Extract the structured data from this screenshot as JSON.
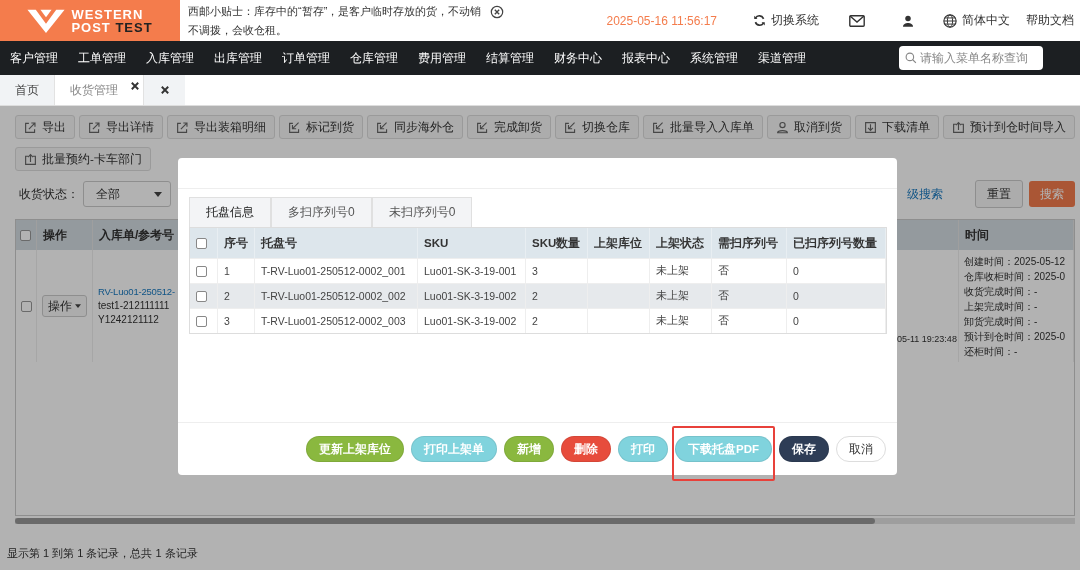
{
  "header": {
    "logo": {
      "line1": "WESTERN",
      "line2a": "POST",
      "line2b": "TEST"
    },
    "tip": "西邮小贴士：库存中的“暂存”，是客户临时存放的货，不动销不调拨，会收仓租。",
    "datetime": "2025-05-16 11:56:17",
    "switch_system": "切换系统",
    "language": "简体中文",
    "help": "帮助文档"
  },
  "nav": {
    "items": [
      "客户管理",
      "工单管理",
      "入库管理",
      "出库管理",
      "订单管理",
      "仓库管理",
      "费用管理",
      "结算管理",
      "财务中心",
      "报表中心",
      "系统管理",
      "渠道管理"
    ],
    "search": {
      "placeholder": "请输入菜单名称查询"
    }
  },
  "page_tabs": [
    {
      "label": "首页",
      "selected": false,
      "closable": false
    },
    {
      "label": "收货管理",
      "selected": true,
      "closable": true
    }
  ],
  "close_all_tab": true,
  "toolbar": [
    {
      "label": "导出",
      "kind": "export"
    },
    {
      "label": "导出详情",
      "kind": "export"
    },
    {
      "label": "导出装箱明细",
      "kind": "export"
    },
    {
      "label": "标记到货",
      "kind": "import"
    },
    {
      "label": "同步海外仓",
      "kind": "import"
    },
    {
      "label": "完成卸货",
      "kind": "import"
    },
    {
      "label": "切换仓库",
      "kind": "import"
    },
    {
      "label": "批量导入入库单",
      "kind": "import"
    },
    {
      "label": "取消到货",
      "kind": "user"
    },
    {
      "label": "下载清单",
      "kind": "download"
    },
    {
      "label": "预计到仓时间导入",
      "kind": "upload"
    },
    {
      "label": "批量预约-卡车部门",
      "kind": "upload"
    }
  ],
  "filter": {
    "label": "收货状态：",
    "select_value": "全部",
    "advanced_search": "级搜索",
    "reset": "重置",
    "search": "搜索"
  },
  "table": {
    "select_all_checked": false,
    "columns": [
      "操作",
      "入库单/参考号",
      "时间"
    ],
    "rows": [
      {
        "checked": false,
        "action": "操作",
        "order_link": "RV-Luo01-250512-",
        "reference_1": "test1-212111111",
        "reference_2": "Y1242121112",
        "column_4": "05-11 19:23:48",
        "time_lines": [
          "创建时间：2025-05-12",
          "仓库收柜时间：2025-0",
          "收货完成时间：-",
          "上架完成时间：-",
          "卸货完成时间：-",
          "预计到仓时间：2025-0",
          "还柜时间：-"
        ]
      }
    ]
  },
  "status": "显示第 1 到第 1 条记录，总共 1 条记录",
  "modal": {
    "tabs": [
      {
        "label": "托盘信息",
        "selected": true
      },
      {
        "label": "多扫序列号0",
        "selected": false
      },
      {
        "label": "未扫序列号0",
        "selected": false
      }
    ],
    "select_all_checked": false,
    "columns": [
      "序号",
      "托盘号",
      "SKU",
      "SKU数量",
      "上架库位",
      "上架状态",
      "需扫序列号",
      "已扫序列号数量"
    ],
    "rows": [
      {
        "checked": false,
        "cells": [
          "1",
          "T-RV-Luo01-250512-0002_001",
          "Luo01-SK-3-19-001",
          "3",
          "",
          "未上架",
          "否",
          "0"
        ]
      },
      {
        "checked": false,
        "cells": [
          "2",
          "T-RV-Luo01-250512-0002_002",
          "Luo01-SK-3-19-002",
          "2",
          "",
          "未上架",
          "否",
          "0"
        ]
      },
      {
        "checked": false,
        "cells": [
          "3",
          "T-RV-Luo01-250512-0002_003",
          "Luo01-SK-3-19-002",
          "2",
          "",
          "未上架",
          "否",
          "0"
        ]
      }
    ],
    "buttons": [
      {
        "label": "更新上架库位",
        "color": "#8ab83f",
        "highlighted": false
      },
      {
        "label": "打印上架单",
        "color": "#80d3dd",
        "highlighted": false
      },
      {
        "label": "新增",
        "color": "#8ab83f",
        "highlighted": false
      },
      {
        "label": "删除",
        "color": "#e74c3c",
        "highlighted": false
      },
      {
        "label": "打印",
        "color": "#80d3dd",
        "highlighted": false
      },
      {
        "label": "下载托盘PDF",
        "color": "#80d3dd",
        "highlighted": true
      },
      {
        "label": "保存",
        "color": "#2e3d56",
        "highlighted": false
      },
      {
        "label": "取消",
        "color": "#ffffff",
        "highlighted": false
      }
    ]
  }
}
